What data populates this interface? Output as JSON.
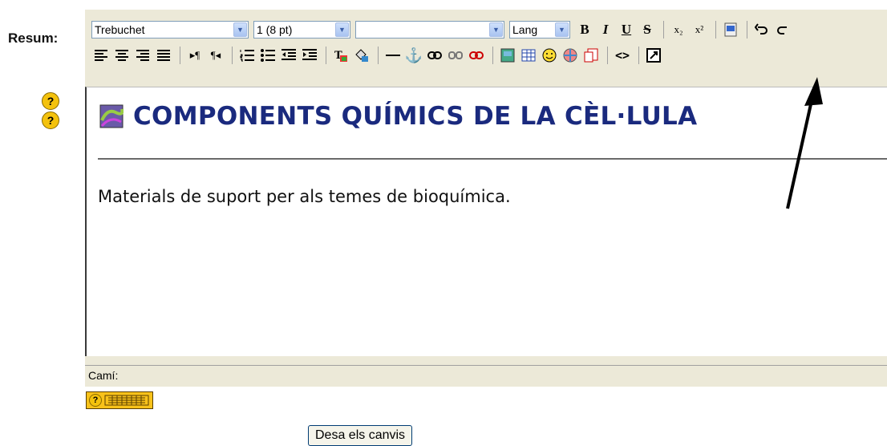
{
  "form": {
    "summary_label": "Resum:"
  },
  "toolbar": {
    "font_family": "Trebuchet",
    "font_size": "1 (8 pt)",
    "format_block": "",
    "lang": "Lang",
    "bold": "B",
    "italic": "I",
    "underline": "U",
    "strikethrough": "S",
    "subscript": "x₂",
    "superscript": "x²",
    "icons_row1": [
      "bold-icon",
      "italic-icon",
      "underline-icon",
      "strikethrough-icon",
      "subscript-icon",
      "superscript-icon",
      "paste-word-icon",
      "undo-icon",
      "redo-icon"
    ],
    "icons_row2": [
      "align-left-icon",
      "align-center-icon",
      "align-right-icon",
      "justify-icon",
      "ltr-icon",
      "rtl-icon",
      "ordered-list-icon",
      "unordered-list-icon",
      "outdent-icon",
      "indent-icon",
      "text-color-icon",
      "background-color-icon",
      "horizontal-rule-icon",
      "anchor-icon",
      "link-icon",
      "unlink-icon",
      "nolink-icon",
      "insert-image-icon",
      "insert-table-icon",
      "smiley-icon",
      "insert-object-icon",
      "search-replace-icon",
      "html-source-icon",
      "fullscreen-icon"
    ]
  },
  "editor": {
    "heading": "COMPONENTS QUÍMICS DE LA CÈL·LULA",
    "body": "Materials de suport per als temes de bioquímica.",
    "path_label": "Camí:"
  },
  "help": {
    "icon_text": "?"
  },
  "actions": {
    "save_label": "Desa els canvis"
  },
  "colors": {
    "heading": "#1a2a7e",
    "toolbar_bg": "#ece9d8",
    "help_yellow": "#f4c20d"
  }
}
